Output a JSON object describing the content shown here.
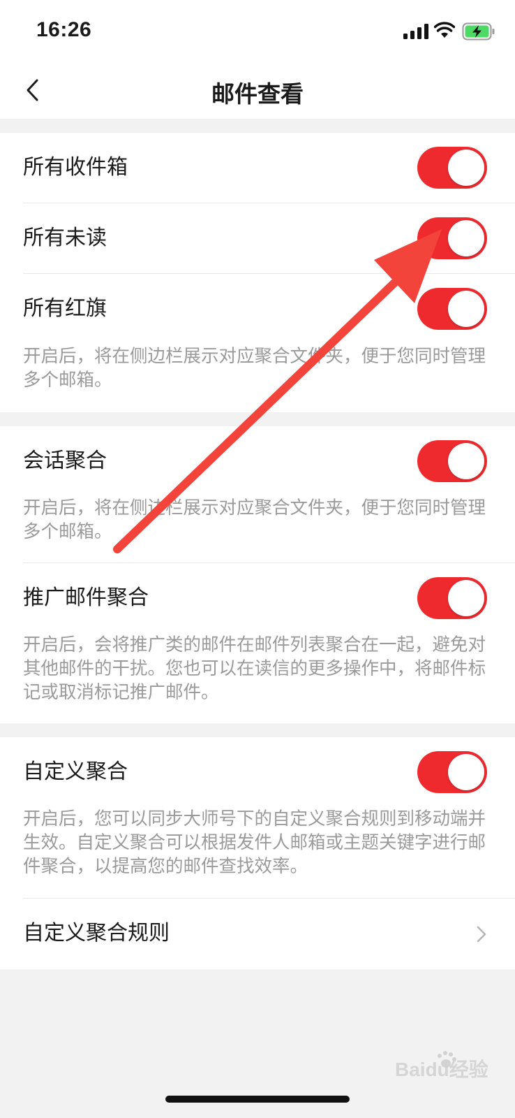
{
  "status_bar": {
    "time": "16:26"
  },
  "nav": {
    "title": "邮件查看"
  },
  "group1": {
    "rows": [
      {
        "label": "所有收件箱",
        "enabled": true
      },
      {
        "label": "所有未读",
        "enabled": true
      },
      {
        "label": "所有红旗",
        "enabled": true
      }
    ],
    "description": "开启后，将在侧边栏展示对应聚合文件夹，便于您同时管理多个邮箱。"
  },
  "group2": {
    "conversation": {
      "label": "会话聚合",
      "enabled": true,
      "description": "开启后，将在侧边栏展示对应聚合文件夹，便于您同时管理多个邮箱。"
    },
    "promotion": {
      "label": "推广邮件聚合",
      "enabled": true,
      "description": "开启后，会将推广类的邮件在邮件列表聚合在一起，避免对其他邮件的干扰。您也可以在读信的更多操作中，将邮件标记或取消标记推广邮件。"
    }
  },
  "group3": {
    "custom": {
      "label": "自定义聚合",
      "enabled": true,
      "description": "开启后，您可以同步大师号下的自定义聚合规则到移动端并生效。自定义聚合可以根据发件人邮箱或主题关键字进行邮件聚合，以提高您的邮件查找效率。"
    },
    "rules": {
      "label": "自定义聚合规则"
    }
  },
  "colors": {
    "switch_on": "#ee2a2f",
    "annotation_arrow": "#f3443c",
    "background": "#f2f2f2"
  },
  "watermark": {
    "text": "Baidu经验"
  }
}
